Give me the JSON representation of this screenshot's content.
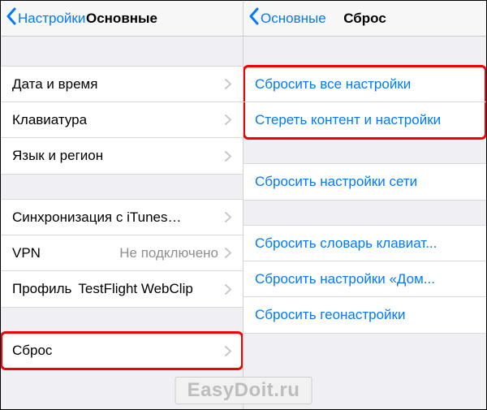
{
  "left": {
    "back_label": "Настройки",
    "title": "Основные",
    "group1": [
      {
        "label": "Дата и время"
      },
      {
        "label": "Клавиатура"
      },
      {
        "label": "Язык и регион"
      }
    ],
    "group2": [
      {
        "label": "Синхронизация с iTunes…",
        "value": ""
      },
      {
        "label": "VPN",
        "value": "Не подключено"
      },
      {
        "label": "Профиль",
        "value": "TestFlight WebClip"
      }
    ],
    "group3": [
      {
        "label": "Сброс"
      }
    ]
  },
  "right": {
    "back_label": "Основные",
    "title": "Сброс",
    "group1": [
      {
        "label": "Сбросить все настройки"
      },
      {
        "label": "Стереть контент и настройки"
      }
    ],
    "group2": [
      {
        "label": "Сбросить настройки сети"
      }
    ],
    "group3": [
      {
        "label": "Сбросить словарь клавиат..."
      },
      {
        "label": "Сбросить настройки «Дом..."
      },
      {
        "label": "Сбросить геонастройки"
      }
    ]
  },
  "watermark": "EasyDoit.ru"
}
